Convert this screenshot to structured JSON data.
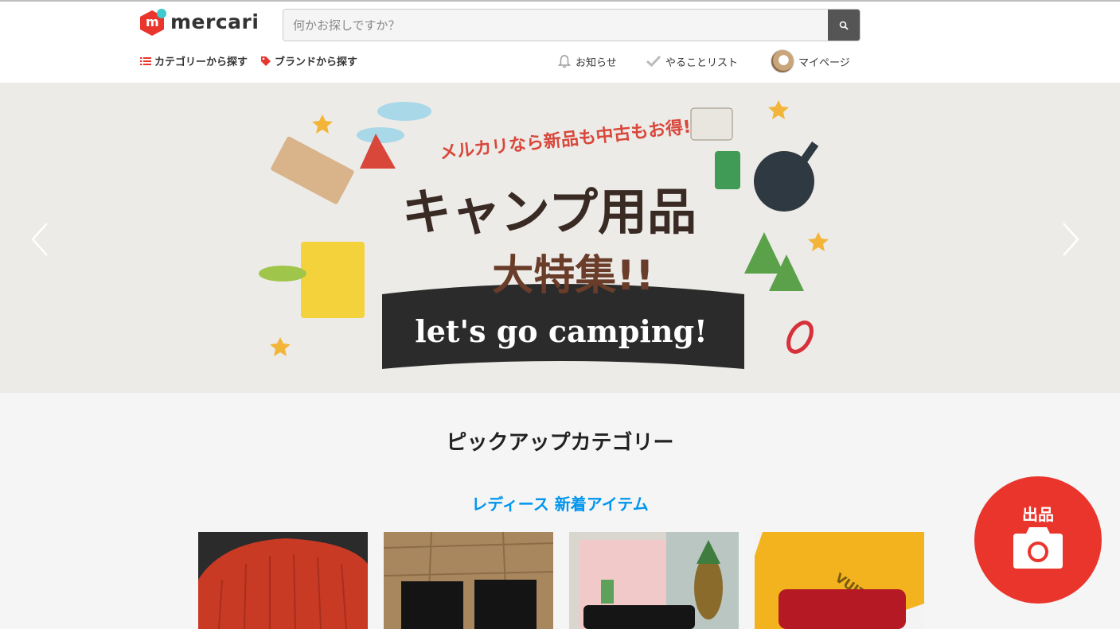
{
  "brand": {
    "name": "mercari",
    "logo_glyph": "m",
    "color": "#ea352d",
    "accent": "#3ccace"
  },
  "search": {
    "placeholder": "何かお探しですか？",
    "value": "",
    "icon": "search-icon"
  },
  "nav_left": [
    {
      "label": "カテゴリーから探す",
      "icon": "list-icon"
    },
    {
      "label": "ブランドから探す",
      "icon": "tag-icon"
    }
  ],
  "nav_right": [
    {
      "label": "お知らせ",
      "icon": "bell-icon"
    },
    {
      "label": "やることリスト",
      "icon": "check-icon"
    },
    {
      "label": "マイページ",
      "icon": "avatar"
    }
  ],
  "banner": {
    "tagline": "メルカリなら新品も中古もお得!",
    "headline_1": "キャンプ用品",
    "headline_2": "大特集!!",
    "ribbon": "let's go camping!",
    "prev_icon": "chevron-left-icon",
    "next_icon": "chevron-right-icon"
  },
  "pickup": {
    "title": "ピックアップカテゴリー",
    "subtitle": "レディース 新着アイテム",
    "items": [
      {
        "name": "red knit beanie"
      },
      {
        "name": "black leggings"
      },
      {
        "name": "black quilted wallet"
      },
      {
        "name": "red leather wallet"
      }
    ]
  },
  "sell_button": {
    "label": "出品",
    "icon": "camera-icon"
  }
}
